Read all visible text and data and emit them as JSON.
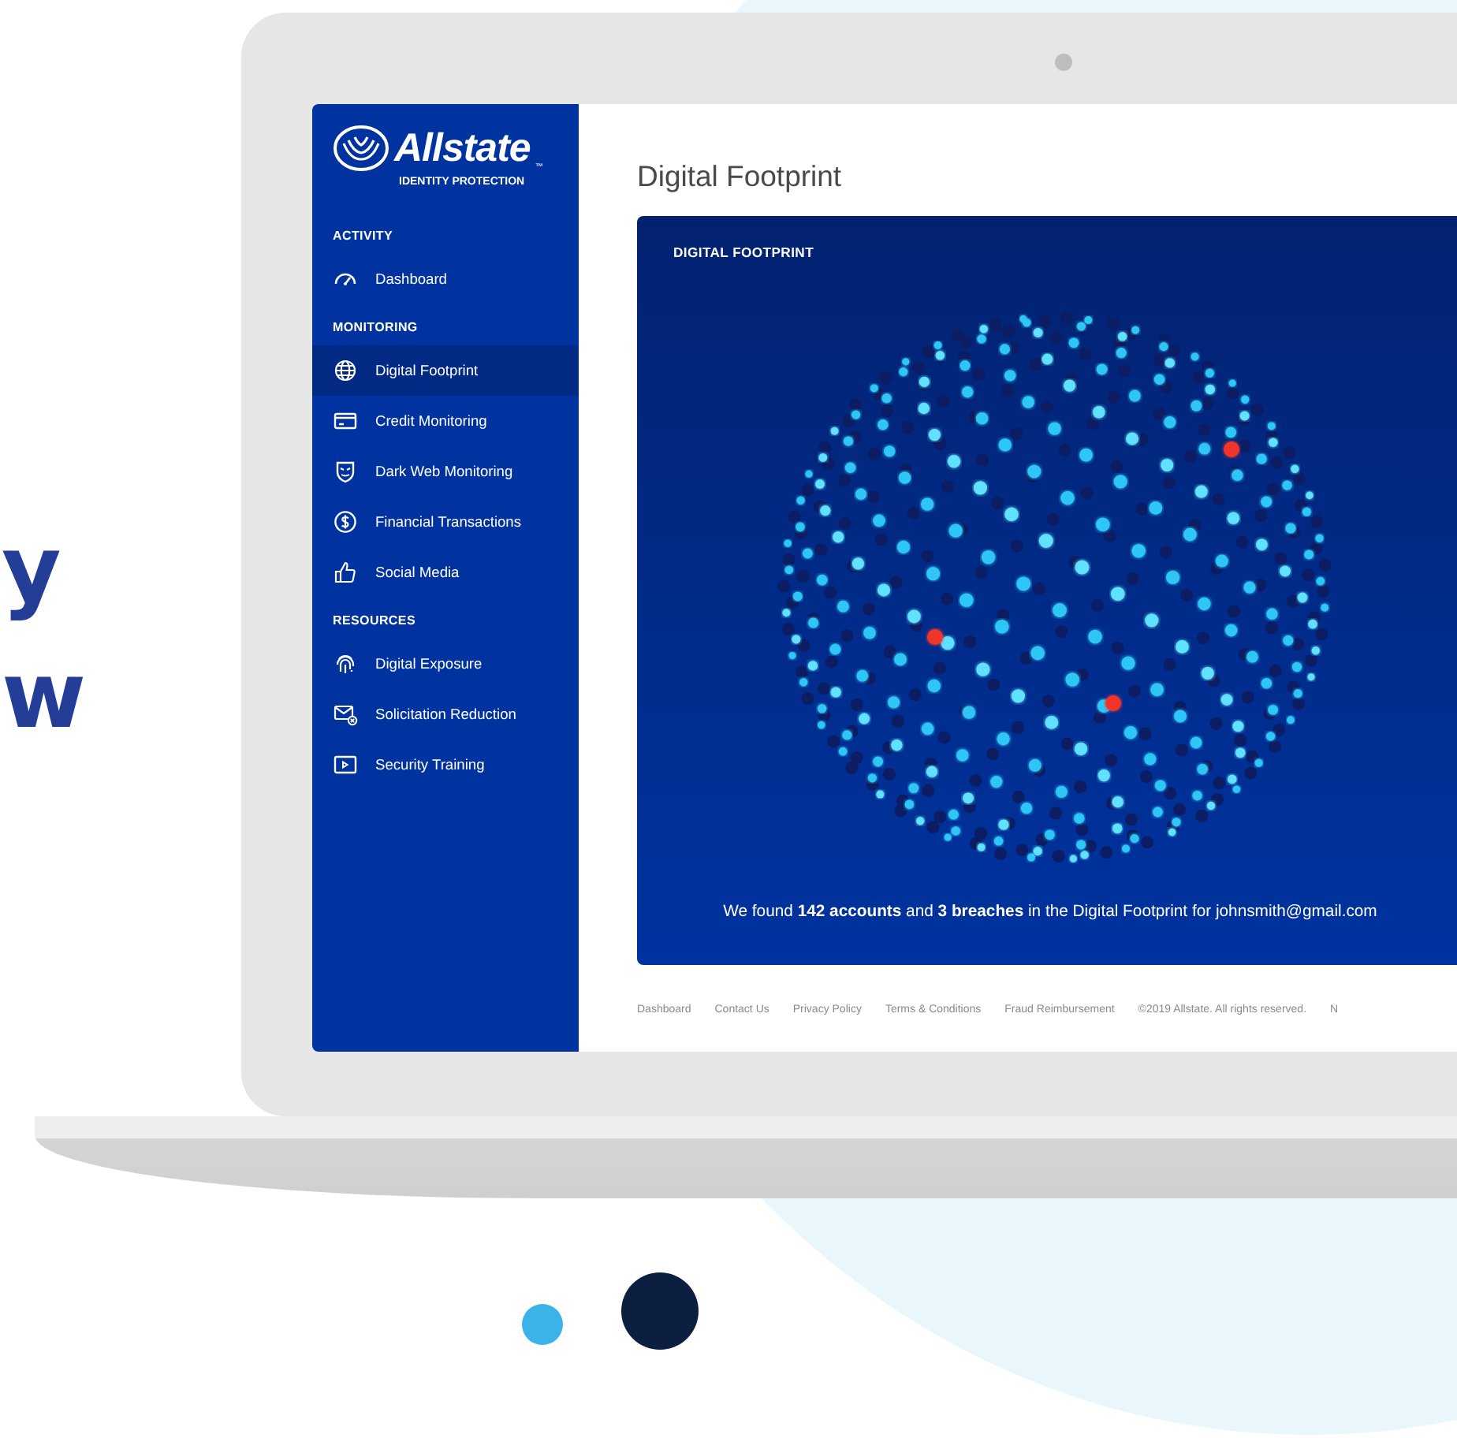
{
  "backdrop_text": [
    "y",
    "w"
  ],
  "sidebar": {
    "brand": "Allstate",
    "trademark": "™",
    "tagline": "IDENTITY PROTECTION",
    "sections": [
      {
        "heading": "ACTIVITY",
        "items": [
          {
            "label": "Dashboard",
            "kind": "gauge",
            "selected": false
          }
        ]
      },
      {
        "heading": "MONITORING",
        "items": [
          {
            "label": "Digital Footprint",
            "kind": "globe",
            "selected": true
          },
          {
            "label": "Credit Monitoring",
            "kind": "card",
            "selected": false
          },
          {
            "label": "Dark Web Monitoring",
            "kind": "mask",
            "selected": false
          },
          {
            "label": "Financial Transactions",
            "kind": "dollar",
            "selected": false
          },
          {
            "label": "Social Media",
            "kind": "thumb",
            "selected": false
          }
        ]
      },
      {
        "heading": "RESOURCES",
        "items": [
          {
            "label": "Digital Exposure",
            "kind": "fingerprint",
            "selected": false
          },
          {
            "label": "Solicitation Reduction",
            "kind": "mail",
            "selected": false
          },
          {
            "label": "Security Training",
            "kind": "video",
            "selected": false
          }
        ]
      }
    ]
  },
  "page": {
    "title": "Digital Footprint",
    "card": {
      "heading": "DIGITAL FOOTPRINT",
      "summary": "We found **142 accounts** and **3 breaches** in the Digital Footprint for johnsmith@gmail.com"
    }
  },
  "footer": {
    "links": [
      "Dashboard",
      "Contact Us",
      "Privacy Policy",
      "Terms & Conditions",
      "Fraud Reimbursement"
    ],
    "copyright": "©2019 Allstate. All rights reserved.",
    "cut_link": "N"
  }
}
